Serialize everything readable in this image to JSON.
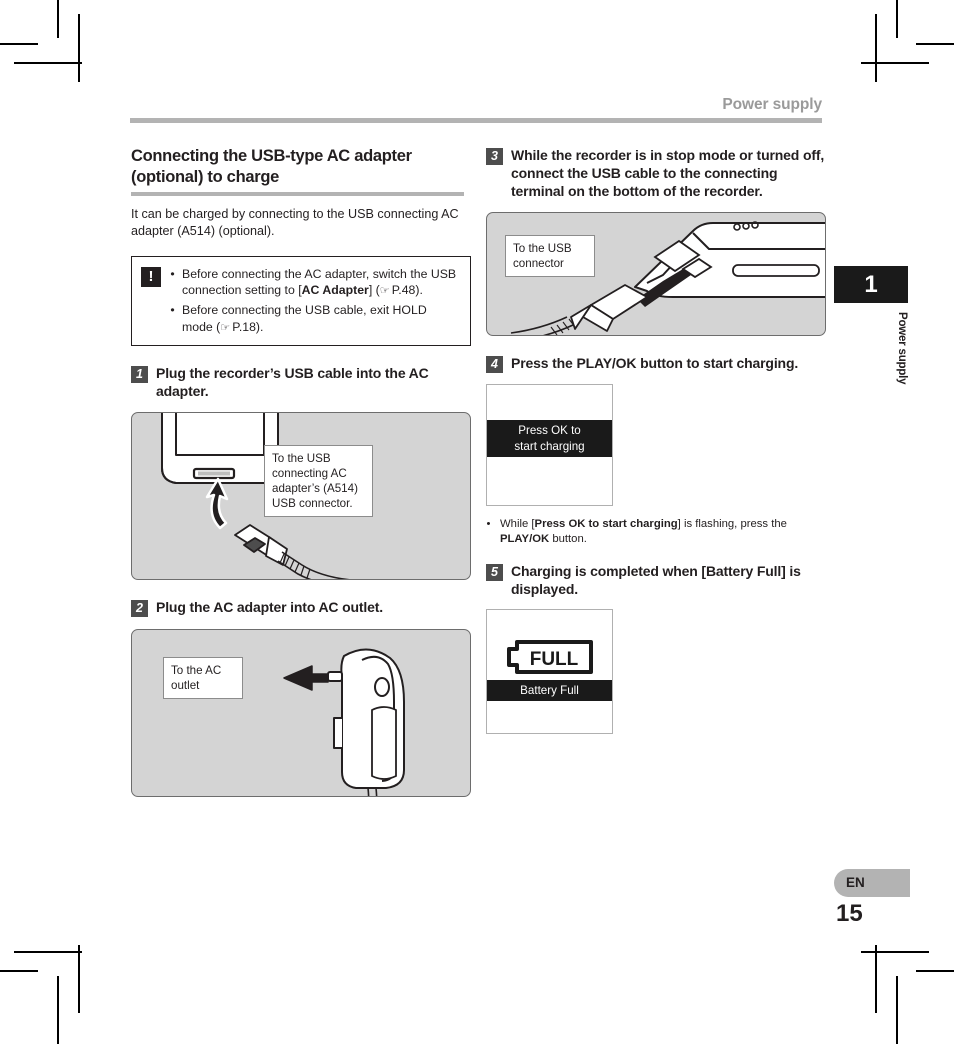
{
  "running_head": "Power supply",
  "section": {
    "heading": "Connecting the USB-type AC adapter (optional) to charge",
    "lead": "It can be charged by connecting to the USB connecting AC adapter (A514) (optional)."
  },
  "caution": {
    "icon": "!",
    "bullets": [
      {
        "pre": "Before connecting the AC adapter, switch the USB connection setting to [",
        "bold": "AC Adapter",
        "post": "] (",
        "ref": "P.48",
        "end": ")."
      },
      {
        "pre": "Before connecting the USB cable, exit HOLD mode (",
        "bold": "",
        "post": "",
        "ref": "P.18",
        "end": ")."
      }
    ]
  },
  "steps": [
    {
      "num": "1",
      "text": "Plug the recorder’s USB cable into the AC adapter."
    },
    {
      "num": "2",
      "text": "Plug the AC adapter into AC outlet."
    },
    {
      "num": "3",
      "text": "While the recorder is in stop mode or turned off, connect the USB cable to the connecting terminal on the bottom of the recorder."
    },
    {
      "num": "4",
      "text_pre": "Press the ",
      "text_bold": "PLAY/OK",
      "text_post": " button to start charging."
    },
    {
      "num": "5",
      "text_pre": "Charging is completed when [",
      "text_bold": "Battery Full",
      "text_post": "] is displayed."
    }
  ],
  "figures": {
    "adapter_usb": {
      "callout": "To the USB connecting AC adapter’s (A514) USB connector."
    },
    "ac_outlet": {
      "callout": "To the AC outlet"
    },
    "recorder_usb": {
      "callout": "To the USB connector"
    }
  },
  "lcd": {
    "charging": {
      "line1": "Press OK to",
      "line2": "start charging"
    },
    "full": {
      "battery_text": "FULL",
      "band": "Battery Full"
    }
  },
  "note_play_ok": {
    "pre": "While [",
    "bold1": "Press OK to start charging",
    "mid": "] is flashing, press the ",
    "bold2": "PLAY/OK",
    "post": " button."
  },
  "chapter": {
    "number": "1",
    "label": "Power supply"
  },
  "footer": {
    "language": "EN",
    "page": "15"
  }
}
